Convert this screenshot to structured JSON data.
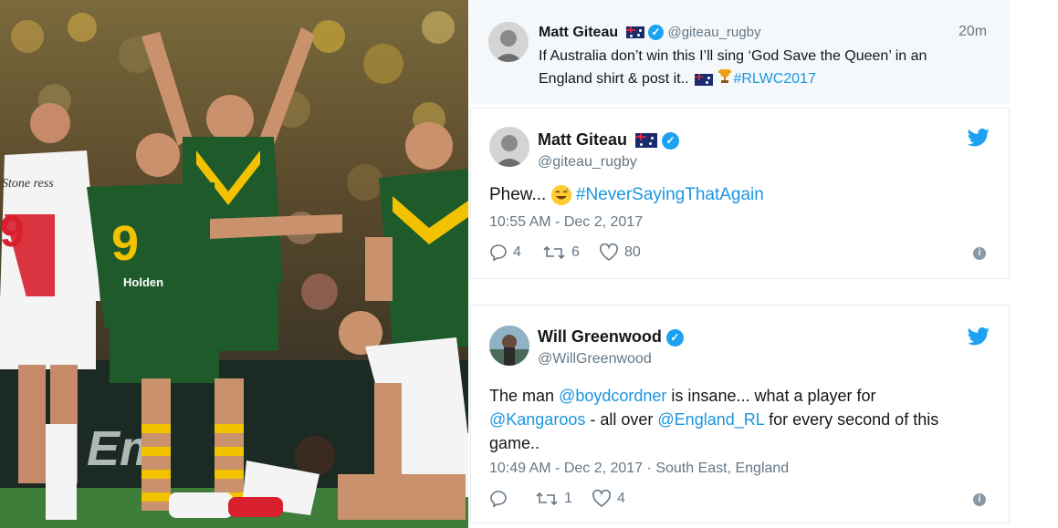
{
  "tweet1": {
    "name": "Matt Giteau",
    "handle": "@giteau_rugby",
    "time": "20m",
    "text_line1": "If Australia don’t win this I’ll sing ‘God Save the Queen’ in an",
    "text_line2": "England shirt & post it..",
    "hashtag": "#RLWC2017"
  },
  "tweet2": {
    "name": "Matt Giteau",
    "handle": "@giteau_rugby",
    "text": "Phew...",
    "hashtag": "#NeverSayingThatAgain",
    "timestamp": "10:55 AM - Dec 2, 2017",
    "replies": "4",
    "retweets": "6",
    "likes": "80"
  },
  "tweet3": {
    "name": "Will Greenwood",
    "handle": "@WillGreenwood",
    "line1_pre": "The man",
    "mention1": "@boydcordner",
    "line1_post": "is insane... what a player for",
    "mention2": "@Kangaroos",
    "line2_mid": "- all over",
    "mention3": "@England_RL",
    "line2_post": "for every second of this",
    "line3": "game..",
    "timestamp": "10:49 AM - Dec 2, 2017 · South East, England",
    "replies": "",
    "retweets": "1",
    "likes": "4"
  },
  "photo": {
    "jersey_number": "9",
    "sponsor": "Holden",
    "shirt_text": "Stone ress",
    "opponent_number": "9",
    "board_text": "Em"
  },
  "colors": {
    "twitter_blue": "#1da1f2",
    "link": "#1b95e0",
    "green": "#1f5a2a",
    "gold": "#f2c200"
  }
}
